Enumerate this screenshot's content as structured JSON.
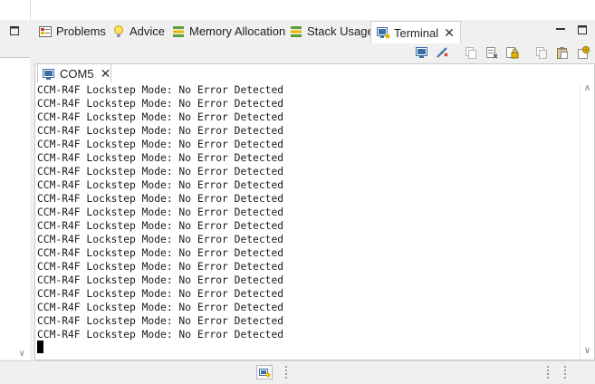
{
  "tabs": [
    {
      "label": "Problems",
      "icon": "problems-icon"
    },
    {
      "label": "Advice",
      "icon": "lightbulb-icon"
    },
    {
      "label": "Memory Allocation",
      "icon": "memory-allocation-icon"
    },
    {
      "label": "Stack Usage",
      "icon": "stack-usage-icon"
    },
    {
      "label": "Terminal",
      "icon": "terminal-icon",
      "active": true
    }
  ],
  "console_tab": {
    "label": "COM5",
    "icon": "monitor-icon"
  },
  "console": {
    "lines": [
      "CCM-R4F Lockstep Mode: No Error Detected",
      "CCM-R4F Lockstep Mode: No Error Detected",
      "CCM-R4F Lockstep Mode: No Error Detected",
      "CCM-R4F Lockstep Mode: No Error Detected",
      "CCM-R4F Lockstep Mode: No Error Detected",
      "CCM-R4F Lockstep Mode: No Error Detected",
      "CCM-R4F Lockstep Mode: No Error Detected",
      "CCM-R4F Lockstep Mode: No Error Detected",
      "CCM-R4F Lockstep Mode: No Error Detected",
      "CCM-R4F Lockstep Mode: No Error Detected",
      "CCM-R4F Lockstep Mode: No Error Detected",
      "CCM-R4F Lockstep Mode: No Error Detected",
      "CCM-R4F Lockstep Mode: No Error Detected",
      "CCM-R4F Lockstep Mode: No Error Detected",
      "CCM-R4F Lockstep Mode: No Error Detected",
      "CCM-R4F Lockstep Mode: No Error Detected",
      "CCM-R4F Lockstep Mode: No Error Detected",
      "CCM-R4F Lockstep Mode: No Error Detected",
      "CCM-R4F Lockstep Mode: No Error Detected"
    ]
  },
  "toolbar_icons": [
    "open-terminal-icon",
    "disconnect-icon",
    "copy-icon",
    "clear-icon",
    "scroll-lock-icon",
    "copy-all-icon",
    "paste-icon",
    "settings-icon"
  ],
  "colors": {
    "active_tab": "#ffffff",
    "background": "#f0f0f0",
    "console_text": "#1a1a1a",
    "icon_blue": "#3a6ea5",
    "icon_red": "#c0392b",
    "icon_yellow": "#e6b800",
    "icon_green": "#5a9e3a"
  }
}
